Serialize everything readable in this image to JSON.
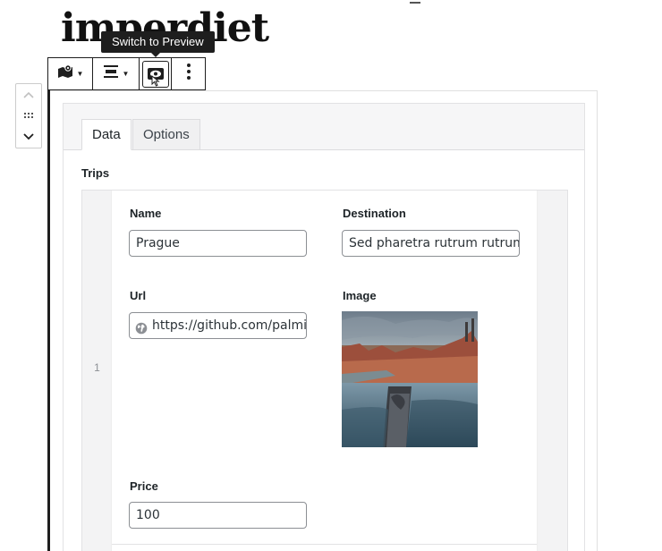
{
  "page": {
    "heading": "imperdiet"
  },
  "tooltip": {
    "text": "Switch to Preview"
  },
  "toolbar": {
    "buttons": [
      {
        "icon": "map-icon",
        "has_dropdown": true
      },
      {
        "icon": "align-center-icon",
        "has_dropdown": true
      },
      {
        "icon": "preview-eye-icon",
        "has_dropdown": false
      },
      {
        "icon": "more-vertical-icon",
        "has_dropdown": false
      }
    ]
  },
  "mover": {
    "icons": [
      "chevron-up-icon",
      "drag-handle-icon",
      "chevron-down-icon"
    ]
  },
  "tabs": [
    {
      "label": "Data",
      "active": true
    },
    {
      "label": "Options",
      "active": false
    }
  ],
  "repeater": {
    "label": "Trips",
    "rows": [
      {
        "index": "1",
        "fields": {
          "name": {
            "label": "Name",
            "value": "Prague"
          },
          "destination": {
            "label": "Destination",
            "value": "Sed pharetra rutrum rutrum. I"
          },
          "url": {
            "label": "Url",
            "value": "https://github.com/palmia",
            "icon": "globe-icon"
          },
          "image": {
            "label": "Image"
          },
          "price": {
            "label": "Price",
            "value": "100"
          }
        }
      }
    ]
  },
  "colors": {
    "accent_dark": "#1e1e1e",
    "panel_bg": "#f6f6f7",
    "input_border": "#8c8f94"
  }
}
